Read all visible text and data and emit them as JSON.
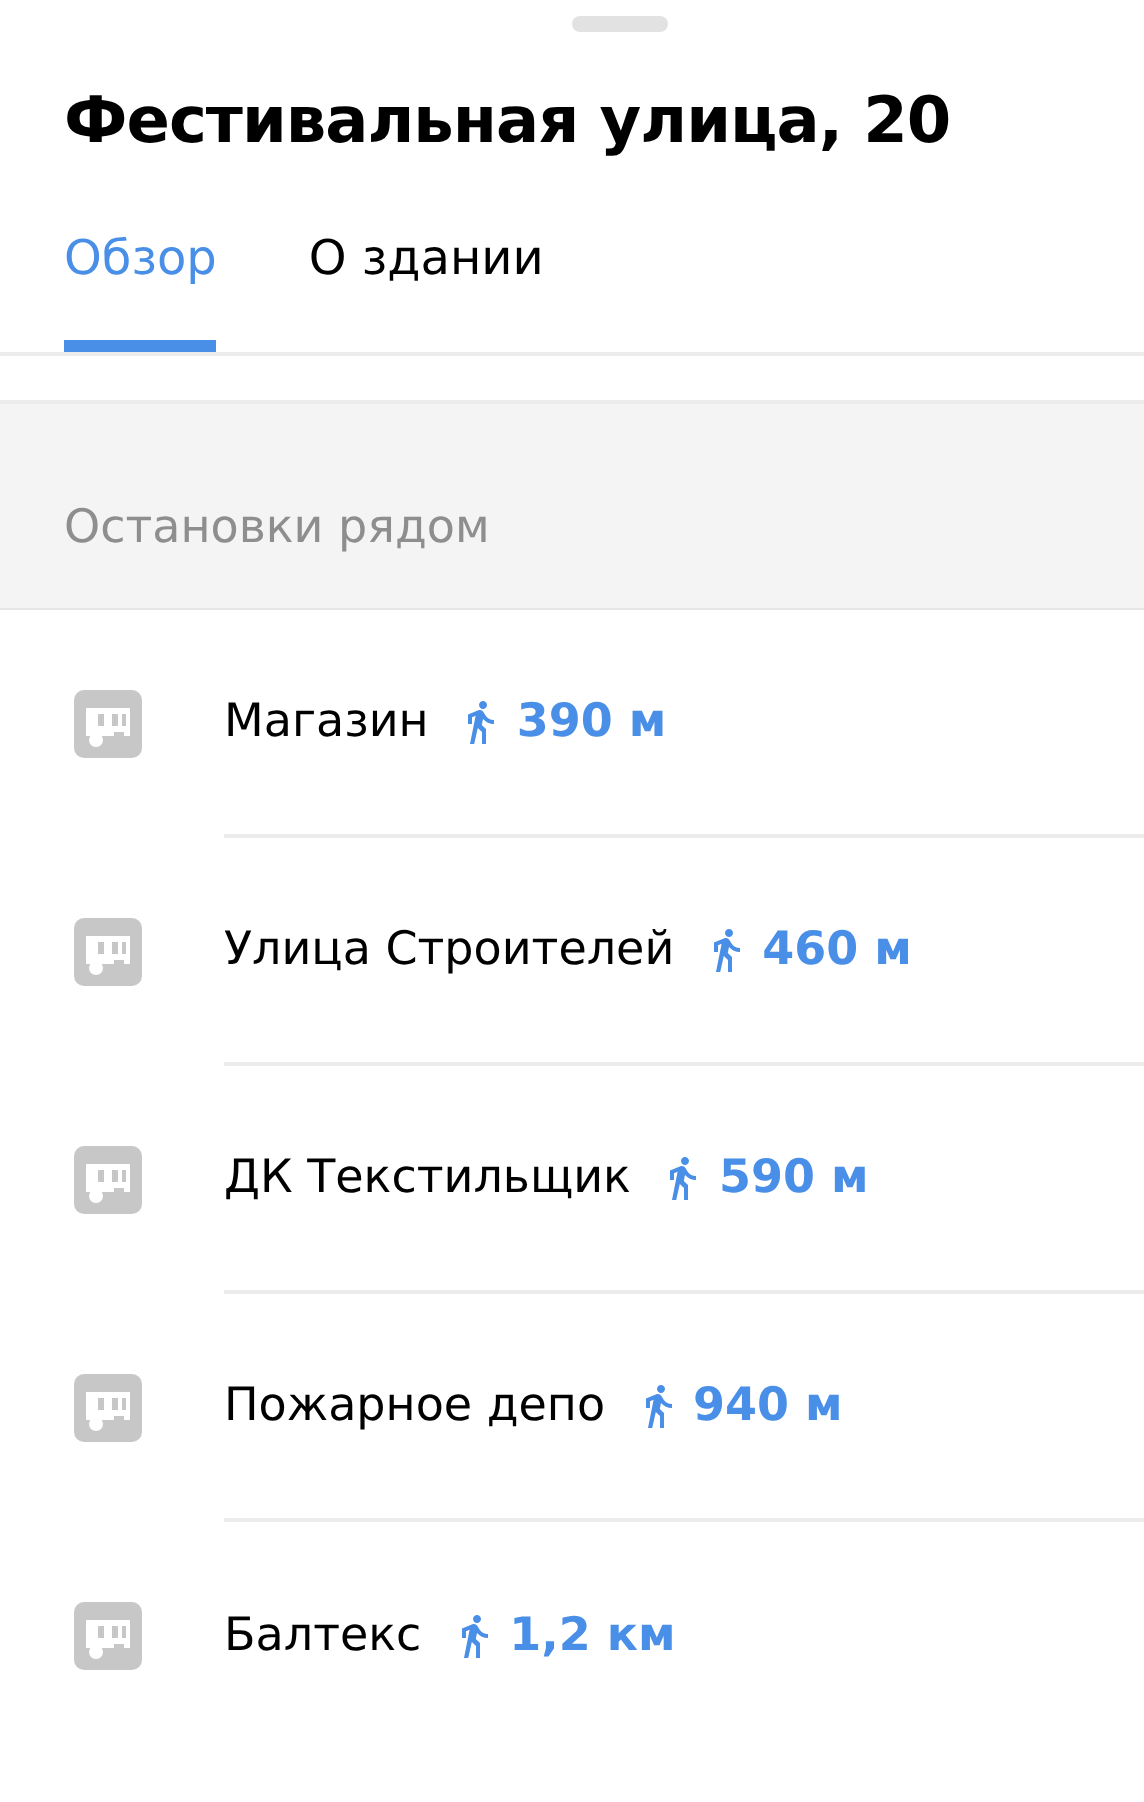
{
  "title": "Фестивальная улица, 20",
  "tabs": [
    {
      "label": "Обзор",
      "selected": true
    },
    {
      "label": "О здании",
      "selected": false
    }
  ],
  "stops_section": {
    "heading": "Остановки рядом",
    "stops": [
      {
        "name": "Магазин",
        "distance": "390 м"
      },
      {
        "name": "Улица Строителей",
        "distance": "460 м"
      },
      {
        "name": "ДК Текстильщик",
        "distance": "590 м"
      },
      {
        "name": "Пожарное депо",
        "distance": "940 м"
      },
      {
        "name": "Балтекс",
        "distance": "1,2 км"
      }
    ]
  }
}
